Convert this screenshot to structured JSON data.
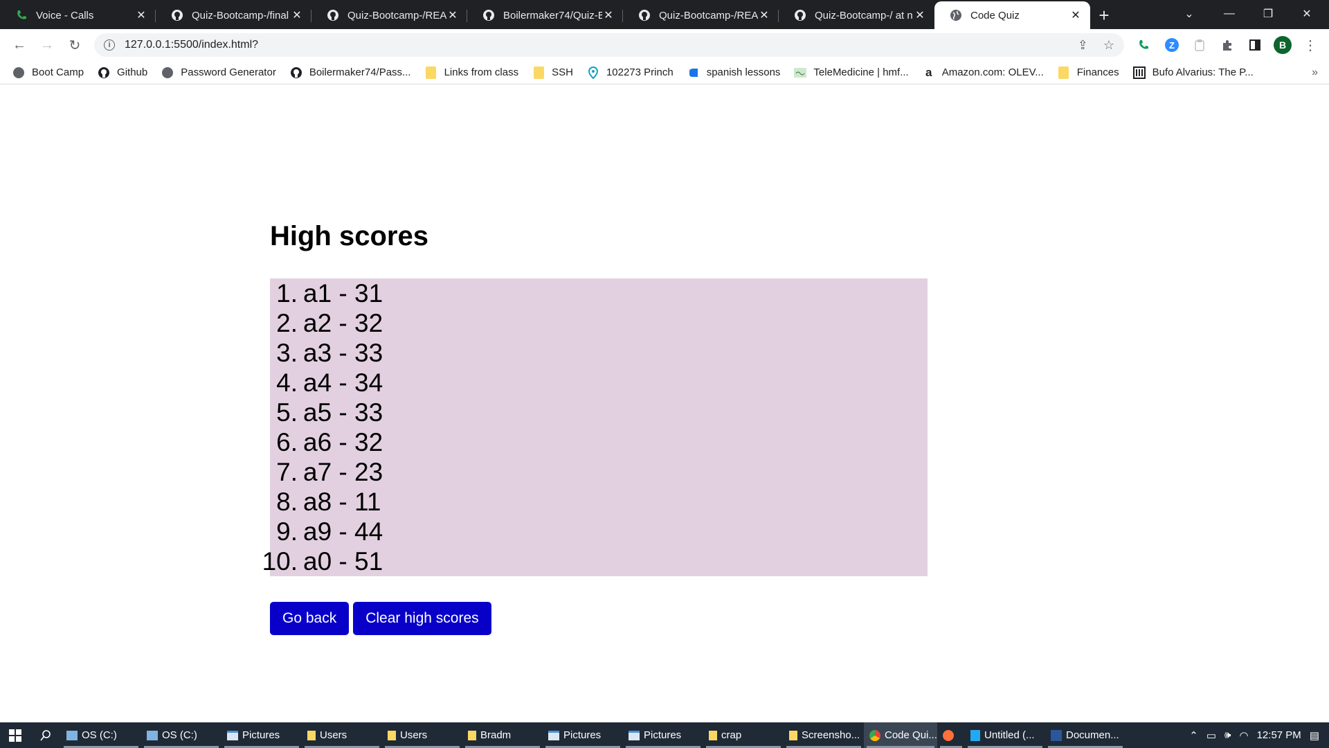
{
  "browser": {
    "tabs": [
      {
        "title": "Voice - Calls",
        "icon": "phone-icon",
        "active": false
      },
      {
        "title": "Quiz-Bootcamp-/final",
        "icon": "github-icon",
        "active": false
      },
      {
        "title": "Quiz-Bootcamp-/REA",
        "icon": "github-icon",
        "active": false
      },
      {
        "title": "Boilermaker74/Quiz-B",
        "icon": "github-icon",
        "active": false
      },
      {
        "title": "Quiz-Bootcamp-/REA",
        "icon": "github-icon",
        "active": false
      },
      {
        "title": "Quiz-Bootcamp-/ at n",
        "icon": "github-icon",
        "active": false
      },
      {
        "title": "Code Quiz",
        "icon": "globe-icon",
        "active": true
      }
    ],
    "url": "127.0.0.1:5500/index.html?",
    "profile_initial": "B",
    "bookmarks": [
      {
        "label": "Boot Camp",
        "icon": "globe-icon"
      },
      {
        "label": "Github",
        "icon": "github-icon"
      },
      {
        "label": "Password Generator",
        "icon": "globe-icon"
      },
      {
        "label": "Boilermaker74/Pass...",
        "icon": "github-icon"
      },
      {
        "label": "Links from class",
        "icon": "folder-icon"
      },
      {
        "label": "SSH",
        "icon": "folder-icon"
      },
      {
        "label": "102273 Princh",
        "icon": "map-pin-icon"
      },
      {
        "label": "spanish lessons",
        "icon": "doc-icon"
      },
      {
        "label": "TeleMedicine | hmf...",
        "icon": "site-icon"
      },
      {
        "label": "Amazon.com: OLEV...",
        "icon": "amazon-icon"
      },
      {
        "label": "Finances",
        "icon": "folder-icon"
      },
      {
        "label": "Bufo Alvarius: The P...",
        "icon": "building-icon"
      }
    ],
    "bookmarks_more": "»"
  },
  "page": {
    "heading": "High scores",
    "scores": [
      {
        "num": "1.",
        "entry": "a1 - 31"
      },
      {
        "num": "2.",
        "entry": "a2 - 32"
      },
      {
        "num": "3.",
        "entry": "a3 - 33"
      },
      {
        "num": "4.",
        "entry": "a4 - 34"
      },
      {
        "num": "5.",
        "entry": "a5 - 33"
      },
      {
        "num": "6.",
        "entry": "a6 - 32"
      },
      {
        "num": "7.",
        "entry": "a7 - 23"
      },
      {
        "num": "8.",
        "entry": "a8 - 11"
      },
      {
        "num": "9.",
        "entry": "a9 - 44"
      },
      {
        "num": "10.",
        "entry": "a0 - 51"
      }
    ],
    "go_back_label": "Go back",
    "clear_label": "Clear high scores"
  },
  "taskbar": {
    "items": [
      {
        "label": "OS (C:)",
        "icon": "drive-icon",
        "active": false
      },
      {
        "label": "OS (C:)",
        "icon": "drive-icon",
        "active": false
      },
      {
        "label": "Pictures",
        "icon": "window-icon",
        "active": false
      },
      {
        "label": "Users",
        "icon": "folder-icon",
        "active": false
      },
      {
        "label": "Users",
        "icon": "folder-icon",
        "active": false
      },
      {
        "label": "Bradm",
        "icon": "folder-icon",
        "active": false
      },
      {
        "label": "Pictures",
        "icon": "window-icon",
        "active": false
      },
      {
        "label": "Pictures",
        "icon": "window-icon",
        "active": false
      },
      {
        "label": "crap",
        "icon": "folder-icon",
        "active": false
      },
      {
        "label": "Screensho...",
        "icon": "folder-icon",
        "active": false
      },
      {
        "label": "Code Qui...",
        "icon": "chrome-icon",
        "active": true
      },
      {
        "label": "",
        "icon": "firefox-icon",
        "active": false
      },
      {
        "label": "Untitled (...",
        "icon": "vscode-icon",
        "active": false
      },
      {
        "label": "Documen...",
        "icon": "word-icon",
        "active": false
      }
    ],
    "time": "12:57 PM"
  },
  "colors": {
    "score_background": "#e2d0e0",
    "button_background": "#0800c9",
    "tabstrip": "#202124",
    "taskbar": "#1f2a36"
  }
}
